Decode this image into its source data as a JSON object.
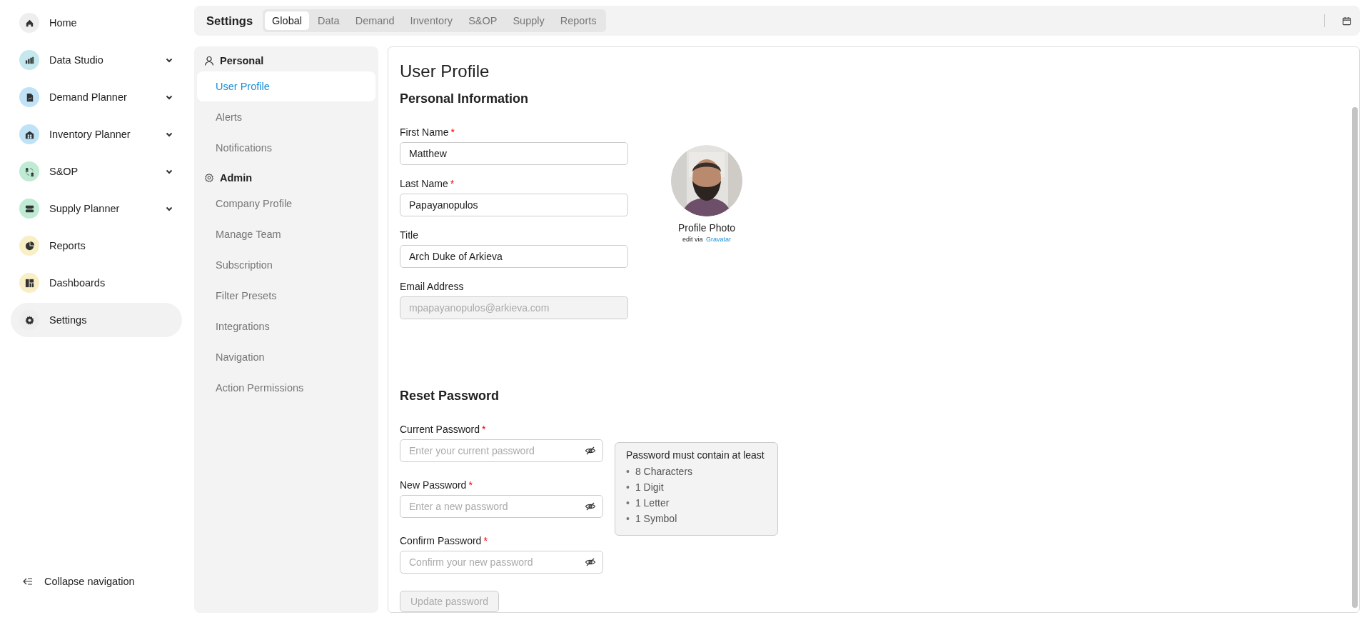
{
  "sidebar": {
    "items": [
      {
        "label": "Home",
        "color": "#eeeeee",
        "has_submenu": false,
        "selected": false
      },
      {
        "label": "Data Studio",
        "color": "#c4e8ee",
        "has_submenu": true,
        "selected": false
      },
      {
        "label": "Demand Planner",
        "color": "#bfe2f6",
        "has_submenu": true,
        "selected": false
      },
      {
        "label": "Inventory Planner",
        "color": "#bfe2f6",
        "has_submenu": true,
        "selected": false
      },
      {
        "label": "S&OP",
        "color": "#bfead4",
        "has_submenu": true,
        "selected": false
      },
      {
        "label": "Supply Planner",
        "color": "#bfead4",
        "has_submenu": true,
        "selected": false
      },
      {
        "label": "Reports",
        "color": "#f8efc6",
        "has_submenu": false,
        "selected": false
      },
      {
        "label": "Dashboards",
        "color": "#f8efc6",
        "has_submenu": false,
        "selected": false
      },
      {
        "label": "Settings",
        "color": "#eeeeee",
        "has_submenu": false,
        "selected": true
      }
    ],
    "collapse": {
      "label": "Collapse navigation"
    }
  },
  "header": {
    "title": "Settings",
    "tabs": [
      {
        "label": "Global",
        "selected": true
      },
      {
        "label": "Data",
        "selected": false
      },
      {
        "label": "Demand",
        "selected": false
      },
      {
        "label": "Inventory",
        "selected": false
      },
      {
        "label": "S&OP",
        "selected": false
      },
      {
        "label": "Supply",
        "selected": false
      },
      {
        "label": "Reports",
        "selected": false
      }
    ]
  },
  "settings_nav": {
    "groups": [
      {
        "label": "Personal",
        "items": [
          {
            "label": "User Profile",
            "selected": true
          },
          {
            "label": "Alerts",
            "selected": false
          },
          {
            "label": "Notifications",
            "selected": false
          }
        ]
      },
      {
        "label": "Admin",
        "items": [
          {
            "label": "Company Profile",
            "selected": false
          },
          {
            "label": "Manage Team",
            "selected": false
          },
          {
            "label": "Subscription",
            "selected": false
          },
          {
            "label": "Filter Presets",
            "selected": false
          },
          {
            "label": "Integrations",
            "selected": false
          },
          {
            "label": "Navigation",
            "selected": false
          },
          {
            "label": "Action Permissions",
            "selected": false
          }
        ]
      }
    ]
  },
  "profile": {
    "title": "User Profile",
    "section": "Personal Information",
    "fields": [
      {
        "label": "First Name",
        "mark": "*",
        "value": "Matthew",
        "disabled": false
      },
      {
        "label": "Last Name",
        "mark": "*",
        "value": "Papayanopulos",
        "disabled": false
      },
      {
        "label": "Title",
        "value": "Arch Duke of Arkieva",
        "disabled": false
      },
      {
        "label": "Email Address",
        "value": "mpapayanopulos@arkieva.com",
        "disabled": true
      }
    ],
    "photo": {
      "kind": "picture",
      "label": "Profile Photo",
      "hint": "edit via",
      "link": "Gravatar"
    }
  },
  "password": {
    "title": "Reset Password",
    "fields": [
      {
        "label": "Current Password",
        "mark": "*",
        "placeholder": "Enter your current password"
      },
      {
        "label": "New Password",
        "mark": "*",
        "placeholder": "Enter a new password"
      },
      {
        "label": "Confirm Password",
        "mark": "*",
        "placeholder": "Confirm your new password"
      }
    ],
    "requirements": {
      "title": "Password must contain at least",
      "marker": "•",
      "items": [
        "8 Characters",
        "1 Digit",
        "1 Letter",
        "1 Symbol"
      ]
    },
    "button": {
      "label": "Update password",
      "disabled": true
    }
  }
}
